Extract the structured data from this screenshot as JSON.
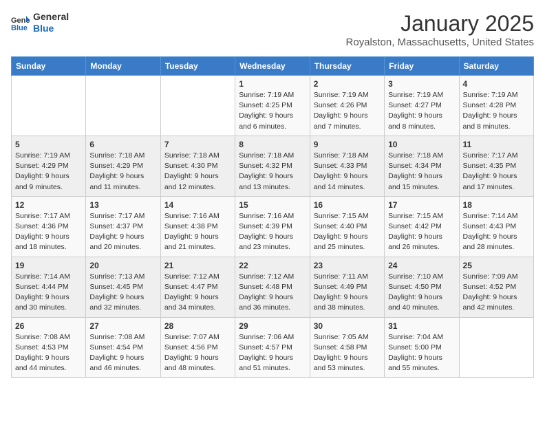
{
  "logo": {
    "line1": "General",
    "line2": "Blue"
  },
  "title": "January 2025",
  "location": "Royalston, Massachusetts, United States",
  "weekdays": [
    "Sunday",
    "Monday",
    "Tuesday",
    "Wednesday",
    "Thursday",
    "Friday",
    "Saturday"
  ],
  "weeks": [
    [
      {
        "day": "",
        "info": ""
      },
      {
        "day": "",
        "info": ""
      },
      {
        "day": "",
        "info": ""
      },
      {
        "day": "1",
        "info": "Sunrise: 7:19 AM\nSunset: 4:25 PM\nDaylight: 9 hours\nand 6 minutes."
      },
      {
        "day": "2",
        "info": "Sunrise: 7:19 AM\nSunset: 4:26 PM\nDaylight: 9 hours\nand 7 minutes."
      },
      {
        "day": "3",
        "info": "Sunrise: 7:19 AM\nSunset: 4:27 PM\nDaylight: 9 hours\nand 8 minutes."
      },
      {
        "day": "4",
        "info": "Sunrise: 7:19 AM\nSunset: 4:28 PM\nDaylight: 9 hours\nand 8 minutes."
      }
    ],
    [
      {
        "day": "5",
        "info": "Sunrise: 7:19 AM\nSunset: 4:29 PM\nDaylight: 9 hours\nand 9 minutes."
      },
      {
        "day": "6",
        "info": "Sunrise: 7:18 AM\nSunset: 4:29 PM\nDaylight: 9 hours\nand 11 minutes."
      },
      {
        "day": "7",
        "info": "Sunrise: 7:18 AM\nSunset: 4:30 PM\nDaylight: 9 hours\nand 12 minutes."
      },
      {
        "day": "8",
        "info": "Sunrise: 7:18 AM\nSunset: 4:32 PM\nDaylight: 9 hours\nand 13 minutes."
      },
      {
        "day": "9",
        "info": "Sunrise: 7:18 AM\nSunset: 4:33 PM\nDaylight: 9 hours\nand 14 minutes."
      },
      {
        "day": "10",
        "info": "Sunrise: 7:18 AM\nSunset: 4:34 PM\nDaylight: 9 hours\nand 15 minutes."
      },
      {
        "day": "11",
        "info": "Sunrise: 7:17 AM\nSunset: 4:35 PM\nDaylight: 9 hours\nand 17 minutes."
      }
    ],
    [
      {
        "day": "12",
        "info": "Sunrise: 7:17 AM\nSunset: 4:36 PM\nDaylight: 9 hours\nand 18 minutes."
      },
      {
        "day": "13",
        "info": "Sunrise: 7:17 AM\nSunset: 4:37 PM\nDaylight: 9 hours\nand 20 minutes."
      },
      {
        "day": "14",
        "info": "Sunrise: 7:16 AM\nSunset: 4:38 PM\nDaylight: 9 hours\nand 21 minutes."
      },
      {
        "day": "15",
        "info": "Sunrise: 7:16 AM\nSunset: 4:39 PM\nDaylight: 9 hours\nand 23 minutes."
      },
      {
        "day": "16",
        "info": "Sunrise: 7:15 AM\nSunset: 4:40 PM\nDaylight: 9 hours\nand 25 minutes."
      },
      {
        "day": "17",
        "info": "Sunrise: 7:15 AM\nSunset: 4:42 PM\nDaylight: 9 hours\nand 26 minutes."
      },
      {
        "day": "18",
        "info": "Sunrise: 7:14 AM\nSunset: 4:43 PM\nDaylight: 9 hours\nand 28 minutes."
      }
    ],
    [
      {
        "day": "19",
        "info": "Sunrise: 7:14 AM\nSunset: 4:44 PM\nDaylight: 9 hours\nand 30 minutes."
      },
      {
        "day": "20",
        "info": "Sunrise: 7:13 AM\nSunset: 4:45 PM\nDaylight: 9 hours\nand 32 minutes."
      },
      {
        "day": "21",
        "info": "Sunrise: 7:12 AM\nSunset: 4:47 PM\nDaylight: 9 hours\nand 34 minutes."
      },
      {
        "day": "22",
        "info": "Sunrise: 7:12 AM\nSunset: 4:48 PM\nDaylight: 9 hours\nand 36 minutes."
      },
      {
        "day": "23",
        "info": "Sunrise: 7:11 AM\nSunset: 4:49 PM\nDaylight: 9 hours\nand 38 minutes."
      },
      {
        "day": "24",
        "info": "Sunrise: 7:10 AM\nSunset: 4:50 PM\nDaylight: 9 hours\nand 40 minutes."
      },
      {
        "day": "25",
        "info": "Sunrise: 7:09 AM\nSunset: 4:52 PM\nDaylight: 9 hours\nand 42 minutes."
      }
    ],
    [
      {
        "day": "26",
        "info": "Sunrise: 7:08 AM\nSunset: 4:53 PM\nDaylight: 9 hours\nand 44 minutes."
      },
      {
        "day": "27",
        "info": "Sunrise: 7:08 AM\nSunset: 4:54 PM\nDaylight: 9 hours\nand 46 minutes."
      },
      {
        "day": "28",
        "info": "Sunrise: 7:07 AM\nSunset: 4:56 PM\nDaylight: 9 hours\nand 48 minutes."
      },
      {
        "day": "29",
        "info": "Sunrise: 7:06 AM\nSunset: 4:57 PM\nDaylight: 9 hours\nand 51 minutes."
      },
      {
        "day": "30",
        "info": "Sunrise: 7:05 AM\nSunset: 4:58 PM\nDaylight: 9 hours\nand 53 minutes."
      },
      {
        "day": "31",
        "info": "Sunrise: 7:04 AM\nSunset: 5:00 PM\nDaylight: 9 hours\nand 55 minutes."
      },
      {
        "day": "",
        "info": ""
      }
    ]
  ]
}
